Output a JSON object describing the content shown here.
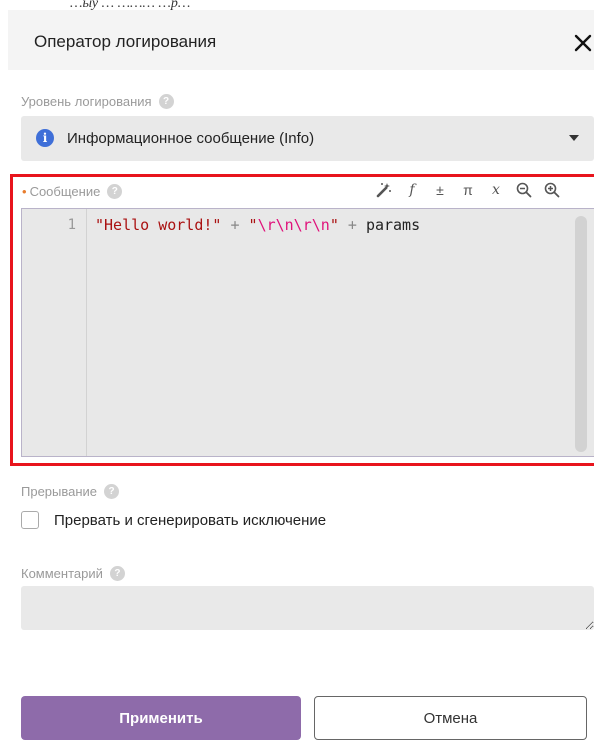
{
  "top_cropped_text": "…ыу … ……… …р…",
  "dialog": {
    "title": "Оператор логирования",
    "close_label": "✕"
  },
  "log_level": {
    "label": "Уровень логирования",
    "help": "?",
    "selected": "Информационное сообщение (Info)",
    "icon_glyph": "i",
    "icon_color": "#3f6fd8"
  },
  "message": {
    "required_marker": "•",
    "label": "Сообщение",
    "help": "?",
    "toolbar": {
      "wand": "🪄",
      "function": "f",
      "plus_minus": "±",
      "pi": "π",
      "variable": "x",
      "zoom_out": "−",
      "zoom_in": "+"
    },
    "line_number": "1",
    "code": {
      "str1": "\"Hello world!\"",
      "op1": " + ",
      "str2_open": "\"",
      "escapes": "\\r\\n\\r\\n",
      "str2_close": "\"",
      "op2": " + ",
      "ident": "params"
    },
    "highlight_color": "#e8141c"
  },
  "interrupt": {
    "label": "Прерывание",
    "help": "?",
    "checkbox_label": "Прервать и сгенерировать исключение",
    "checked": false
  },
  "comment": {
    "label": "Комментарий",
    "help": "?",
    "value": ""
  },
  "buttons": {
    "apply": "Применить",
    "cancel": "Отмена",
    "apply_color": "#8e6baa"
  }
}
